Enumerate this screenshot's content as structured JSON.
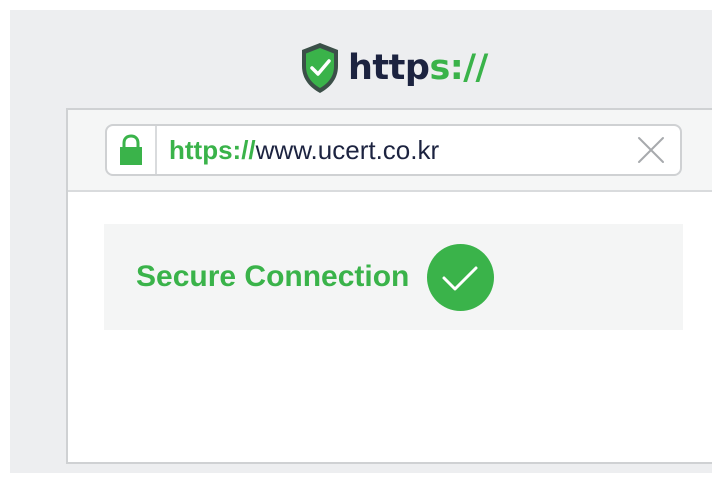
{
  "header": {
    "icon": "shield-check-icon",
    "brand_prefix": "http",
    "brand_suffix": "s://"
  },
  "address_bar": {
    "scheme": "https://",
    "host": "www.ucert.co.kr",
    "lock_icon": "lock-icon",
    "clear_icon": "close-icon"
  },
  "status": {
    "label": "Secure Connection",
    "icon": "check-circle-icon"
  },
  "colors": {
    "accent_green": "#3ab34a",
    "dark_text": "#1c2340",
    "shield_dark": "#3b4f48",
    "background": "#edeef0"
  }
}
